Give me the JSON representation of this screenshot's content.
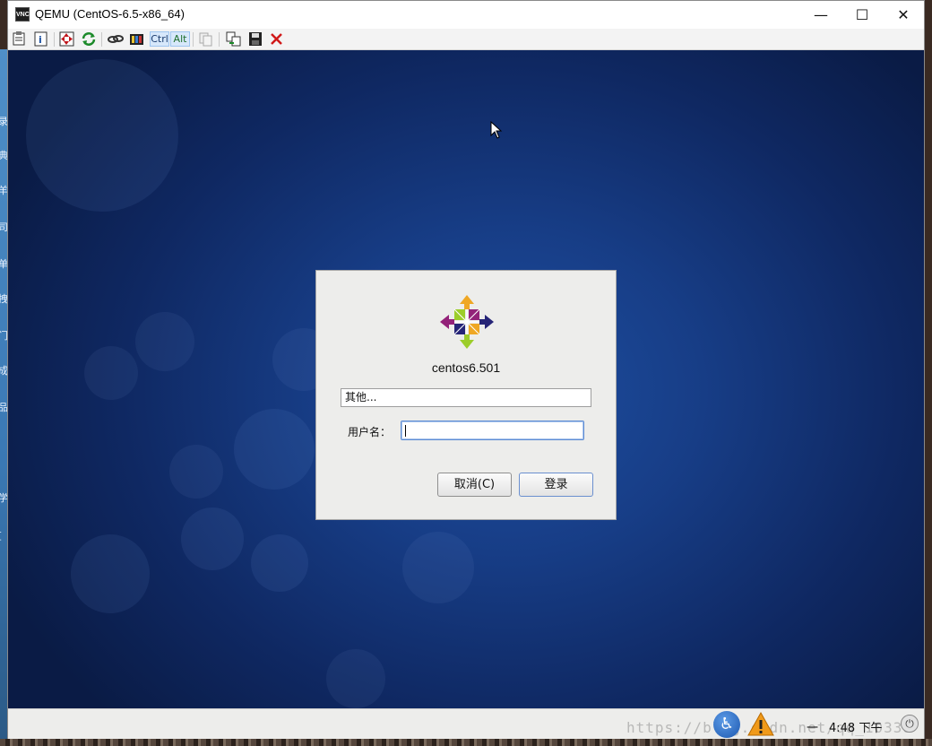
{
  "window": {
    "title": "QEMU (CentOS-6.5-x86_64)",
    "app_icon_text": "VNC",
    "minimize_glyph": "—",
    "maximize_glyph": "☐",
    "close_glyph": "✕"
  },
  "toolbar": {
    "ctrl_label": "Ctrl",
    "alt_label": "Alt",
    "icons": [
      "properties-icon",
      "info-icon",
      "fullscreen-icon",
      "refresh-icon",
      "connect-icon",
      "screenshot-icon",
      "copy-icon",
      "transfer-icon",
      "save-icon",
      "disconnect-icon"
    ]
  },
  "login": {
    "hostname": "centos6.501",
    "user_option": "其他...",
    "username_label": "用户名：",
    "username_value": "",
    "cancel_button": "取消(C)",
    "login_button": "登录"
  },
  "panel": {
    "weekday": "一",
    "time": "4:48 下午",
    "watermark": "https://blog.csdn.net/qq_10338"
  },
  "desktop_left_chars": [
    "录",
    "典",
    "羊",
    "司",
    "单",
    "拽",
    "门",
    "成",
    "品",
    "学",
    "["
  ],
  "colors": {
    "accent": "#5f8dd3",
    "screen_bg": "#173d86",
    "dialog_bg": "#ededeb"
  }
}
